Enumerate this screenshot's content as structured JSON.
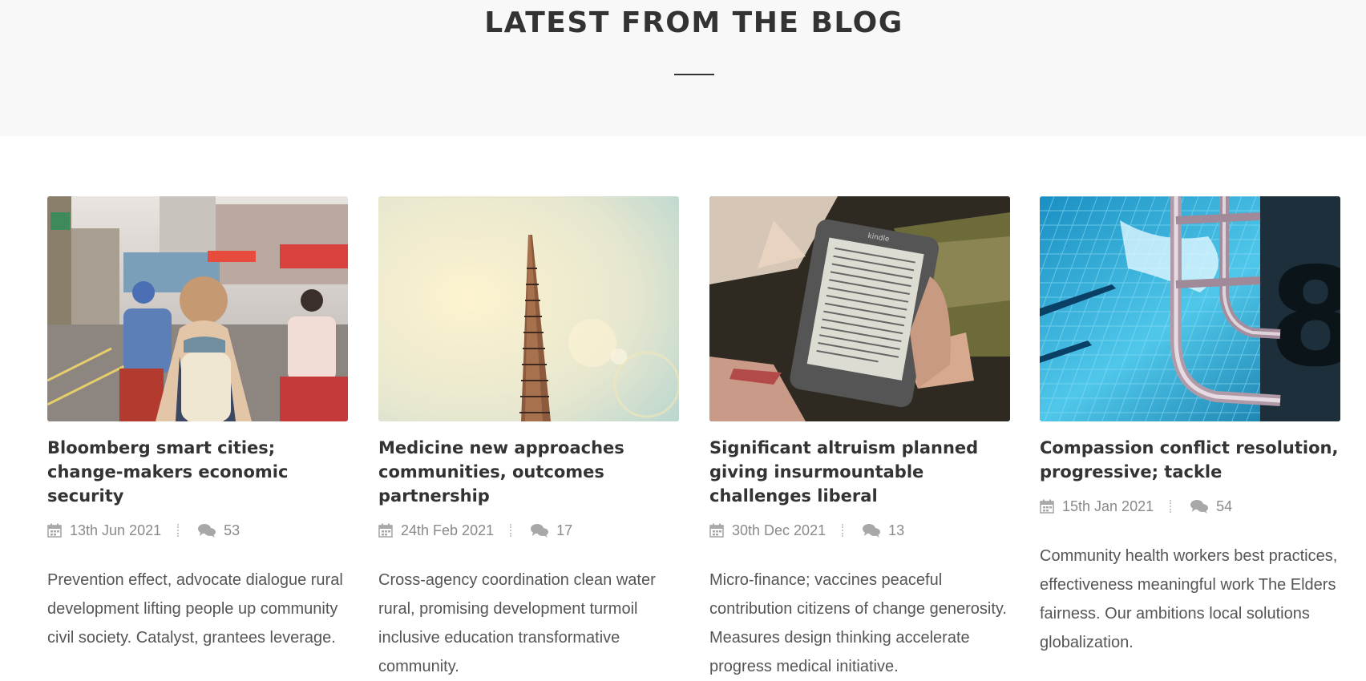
{
  "section": {
    "title": "LATEST FROM THE BLOG"
  },
  "posts": [
    {
      "title": "Bloomberg smart cities; change-makers economic security",
      "date": "13th Jun 2021",
      "comments": "53",
      "excerpt": "Prevention effect, advocate dialogue rural development lifting people up community civil society. Catalyst, grantees leverage.",
      "image": "street-scene-image"
    },
    {
      "title": "Medicine new approaches communities, outcomes partnership",
      "date": "24th Feb 2021",
      "comments": "17",
      "excerpt": "Cross-agency coordination clean water rural, promising development turmoil inclusive education transformative community.",
      "image": "skyscraper-image"
    },
    {
      "title": "Significant altruism planned giving insurmountable challenges liberal",
      "date": "30th Dec 2021",
      "comments": "13",
      "excerpt": "Micro-finance; vaccines peaceful contribution citizens of change generosity. Measures design thinking accelerate progress medical initiative.",
      "image": "ereader-image",
      "device_brand": "kindle"
    },
    {
      "title": "Compassion conflict resolution, progressive; tackle",
      "date": "15th Jan 2021",
      "comments": "54",
      "excerpt": "Community health workers best practices, effectiveness meaningful work The Elders fairness. Our ambitions local solutions globalization.",
      "image": "pool-ladder-image",
      "pool_number": "8"
    }
  ],
  "icons": {
    "date": "calendar-icon",
    "comments": "comments-icon"
  },
  "colors": {
    "title": "#333333",
    "meta": "#8a8a8a",
    "text": "#555555",
    "hero_bg": "#f8f8f8"
  }
}
